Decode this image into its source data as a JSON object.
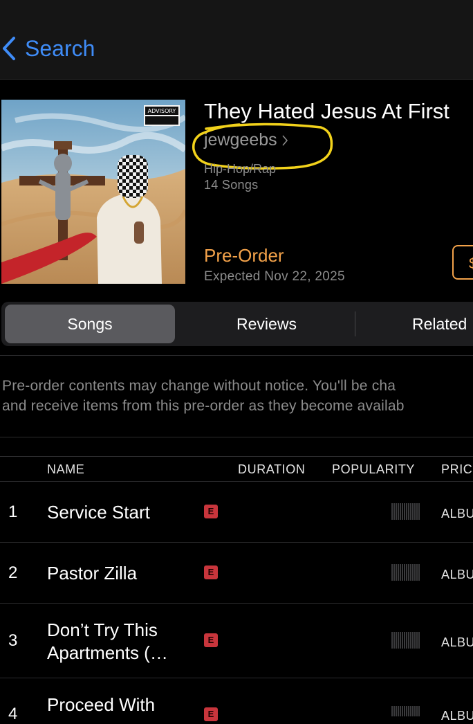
{
  "nav": {
    "back_label": "Search"
  },
  "album": {
    "title": "They Hated Jesus At First",
    "artist": "jewgeebs",
    "genre": "Hip-Hop/Rap",
    "song_count": "14 Songs",
    "preorder_label": "Pre-Order",
    "expected": "Expected Nov 22, 2025",
    "price_button": "$",
    "artwork_text": "ADVISORY"
  },
  "tabs": [
    "Songs",
    "Reviews",
    "Related"
  ],
  "notice": {
    "line1": "Pre-order contents may change without notice. You'll be cha",
    "line2": "and receive items from this pre-order as they become availab"
  },
  "table": {
    "headers": {
      "name": "NAME",
      "duration": "DURATION",
      "popularity": "POPULARITY",
      "price": "PRIC"
    },
    "rows": [
      {
        "num": "1",
        "name": "Service Start",
        "explicit": "E",
        "price": "ALBU"
      },
      {
        "num": "2",
        "name": "Pastor Zilla",
        "explicit": "E",
        "price": "ALBU"
      },
      {
        "num": "3",
        "name": "Don’t Try This Apartments (…",
        "explicit": "E",
        "price": "ALBU"
      },
      {
        "num": "4",
        "name": "Proceed With",
        "explicit": "E",
        "price": "ALBU"
      }
    ]
  },
  "colors": {
    "accent_blue": "#3f8cf7",
    "preorder_orange": "#f3a24a",
    "explicit_red": "#c8353c",
    "highlight_yellow": "#f2d21b"
  }
}
